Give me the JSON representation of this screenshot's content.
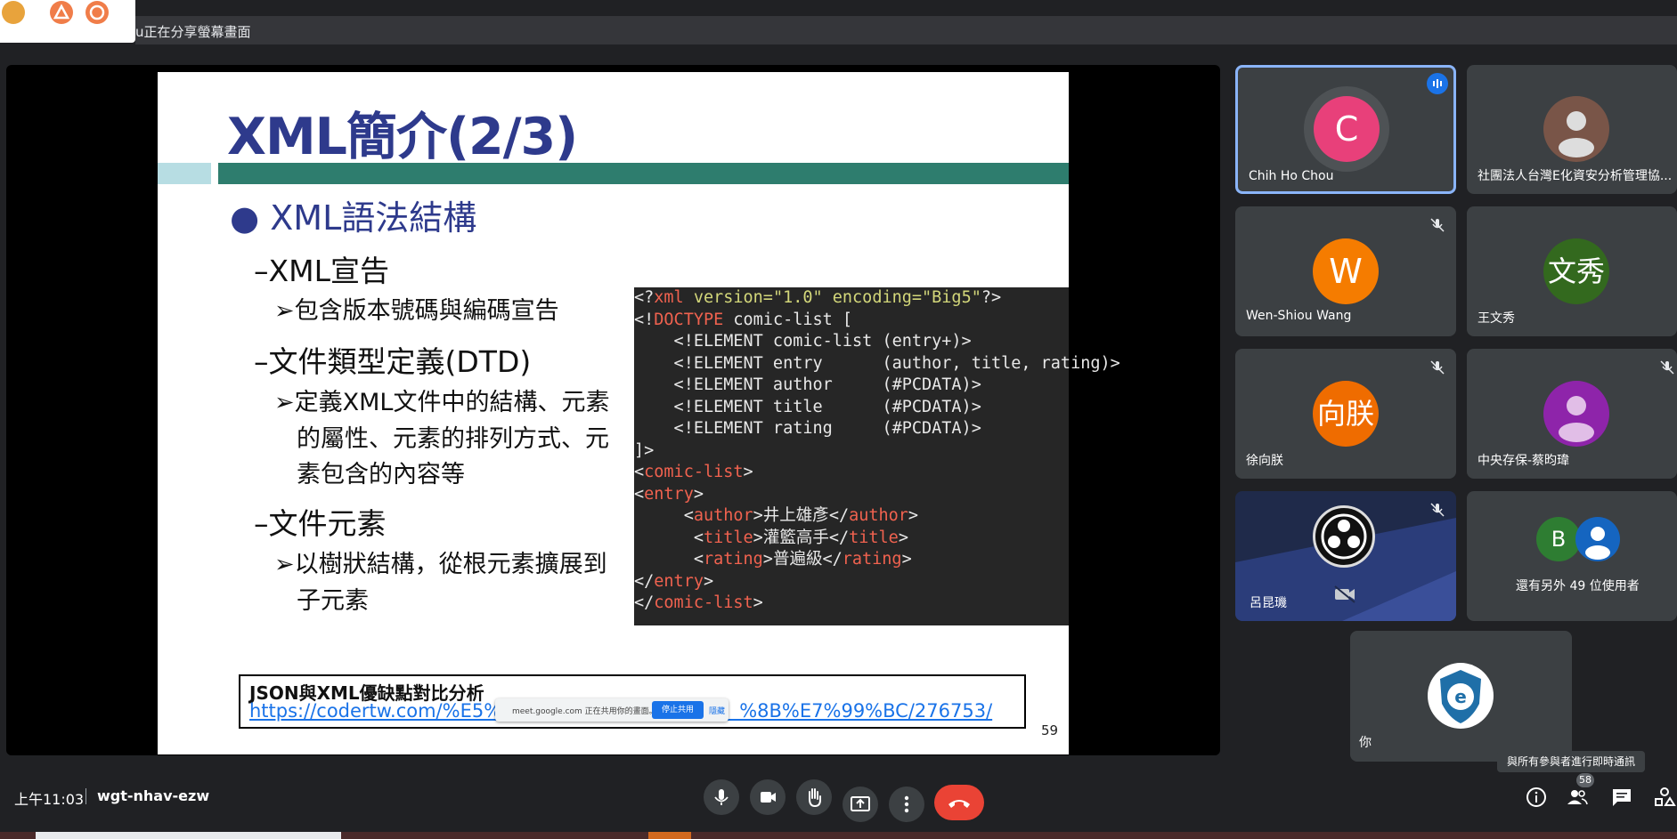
{
  "share_banner": {
    "text": "u正在分享螢幕畫面"
  },
  "slide": {
    "title": "XML簡介(2/3)",
    "bullet_main": "XML語法結構",
    "sub1": "XML宣告",
    "sub1_point": "包含版本號碼與編碼宣告",
    "sub2": "文件類型定義(DTD)",
    "sub2_point_line1": "定義XML文件中的結構、元素",
    "sub2_point_line2": "的屬性、元素的排列方式、元",
    "sub2_point_line3": "素包含的內容等",
    "sub3": "文件元素",
    "sub3_point_line1": "以樹狀結構，從根元素擴展到",
    "sub3_point_line2": "子元素",
    "link_title": "JSON與XML優缺點對比分析",
    "link_url": "https://codertw.com/%E5%89                                    %8B%E7%99%BC/276753/",
    "page_number": "59",
    "code": {
      "l1_a": "<?",
      "l1_b": "xml",
      "l1_c": " version=\"1.0\" encoding=\"Big5\"",
      "l1_d": "?>",
      "l2_a": "<!",
      "l2_b": "DOCTYPE",
      "l2_c": " comic-list [",
      "l3": "    <!ELEMENT comic-list (entry+)>",
      "l4": "    <!ELEMENT entry      (author, title, rating)>",
      "l5": "    <!ELEMENT author     (#PCDATA)>",
      "l6": "    <!ELEMENT title      (#PCDATA)>",
      "l7": "    <!ELEMENT rating     (#PCDATA)>",
      "l8": "]>",
      "l9_tag": "comic-list",
      "l10_tag": "entry",
      "l11_tag": "author",
      "l11_text": "井上雄彥",
      "l12_tag": "title",
      "l12_text": "灌籃高手",
      "l13_tag": "rating",
      "l13_text": "普遍級",
      "l14_tag": "entry",
      "l15_tag": "comic-list"
    }
  },
  "share_popup": {
    "text": "meet.google.com 正在共用你的畫面。",
    "stop_label": "停止共用",
    "hide_label": "隱藏"
  },
  "participants": [
    {
      "name": "Chih Ho Chou",
      "initial": "C",
      "color": "#e8407a"
    },
    {
      "name": "社團法人台灣E化資安分析管理協...",
      "initial": "",
      "color": "#795548"
    },
    {
      "name": "Wen-Shiou Wang",
      "initial": "W",
      "color": "#f57c00"
    },
    {
      "name": "王文秀",
      "initial": "文秀",
      "color": "#33691e"
    },
    {
      "name": "徐向朕",
      "initial": "向朕",
      "color": "#ef6c00"
    },
    {
      "name": "中央存保-蔡昀瑋",
      "initial": "",
      "color": "#8e24aa"
    },
    {
      "name": "呂昆璣",
      "initial": "",
      "color": "#1f2a4a"
    },
    {
      "name": "還有另外 49 位使用者",
      "initial": "B",
      "color": "#2e7d32"
    },
    {
      "name": "你",
      "initial": "",
      "color": "#ffffff"
    }
  ],
  "bottom": {
    "time": "上午11:03",
    "meeting_code": "wgt-nhav-ezw",
    "participant_count": "58",
    "chat_tooltip": "與所有參與者進行即時通訊"
  },
  "icons": [
    "mic-icon",
    "camera-icon",
    "raise-hand-icon",
    "present-icon",
    "more-options-icon",
    "end-call-icon",
    "info-icon",
    "people-icon",
    "chat-icon",
    "activities-icon"
  ]
}
